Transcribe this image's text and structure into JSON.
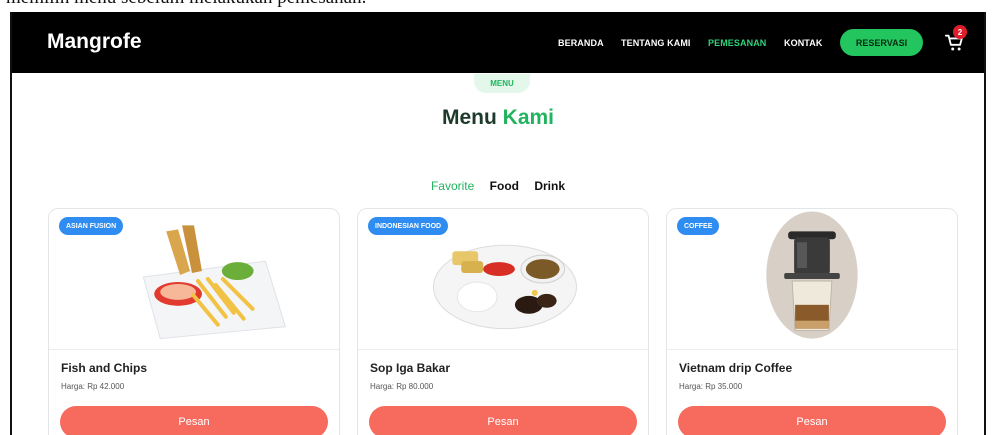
{
  "doc": {
    "caption": "memilih menu sebelum melakukan pemesanan."
  },
  "navbar": {
    "brand": "Mangrofe",
    "links": [
      "BERANDA",
      "TENTANG KAMI",
      "PEMESANAN",
      "KONTAK"
    ],
    "active_link": "PEMESANAN",
    "reserve_label": "RESERVASI",
    "cart_count": "2",
    "accent_color": "#22c55e"
  },
  "section": {
    "pill": "MENU",
    "title_main": "Menu",
    "title_accent": "Kami",
    "tabs": [
      "Favorite",
      "Food",
      "Drink"
    ],
    "active_tab": "Favorite"
  },
  "cards": [
    {
      "badge": "ASIAN FUSION",
      "title": "Fish and Chips",
      "price": "Harga: Rp 42.000",
      "button": "Pesan",
      "image": "fish-and-chips-plate"
    },
    {
      "badge": "INDONESIAN FOOD",
      "title": "Sop Iga Bakar",
      "price": "Harga: Rp 80.000",
      "button": "Pesan",
      "image": "grilled-ribs-soup-plate"
    },
    {
      "badge": "COFFEE",
      "title": "Vietnam drip Coffee",
      "price": "Harga: Rp 35.000",
      "button": "Pesan",
      "image": "vietnam-drip-coffee-glass"
    }
  ]
}
